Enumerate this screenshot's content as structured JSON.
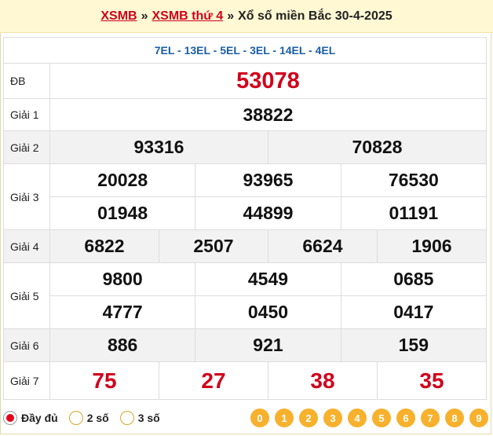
{
  "header": {
    "link1": "XSMB",
    "link2": "XSMB thứ 4",
    "sep": "»",
    "title": "Xổ số miền Bắc 30-4-2025"
  },
  "codes": "7EL - 13EL - 5EL - 3EL - 14EL - 4EL",
  "prizes": {
    "db": {
      "label": "ĐB",
      "values": [
        "53078"
      ]
    },
    "g1": {
      "label": "Giải 1",
      "values": [
        "38822"
      ]
    },
    "g2": {
      "label": "Giải 2",
      "values": [
        "93316",
        "70828"
      ]
    },
    "g3": {
      "label": "Giải 3",
      "values": [
        "20028",
        "93965",
        "76530",
        "01948",
        "44899",
        "01191"
      ]
    },
    "g4": {
      "label": "Giải 4",
      "values": [
        "6822",
        "2507",
        "6624",
        "1906"
      ]
    },
    "g5": {
      "label": "Giải 5",
      "values": [
        "9800",
        "4549",
        "0685",
        "4777",
        "0450",
        "0417"
      ]
    },
    "g6": {
      "label": "Giải 6",
      "values": [
        "886",
        "921",
        "159"
      ]
    },
    "g7": {
      "label": "Giải 7",
      "values": [
        "75",
        "27",
        "38",
        "35"
      ]
    }
  },
  "footer": {
    "options": [
      "Đầy đủ",
      "2 số",
      "3 số"
    ],
    "selected": "Đầy đủ",
    "digits": [
      "0",
      "1",
      "2",
      "3",
      "4",
      "5",
      "6",
      "7",
      "8",
      "9"
    ]
  },
  "colors": {
    "accent_red": "#d0021b",
    "header_bg": "#fff8d3",
    "digit_orange": "#f7b12d",
    "code_blue": "#1b5fa6"
  }
}
